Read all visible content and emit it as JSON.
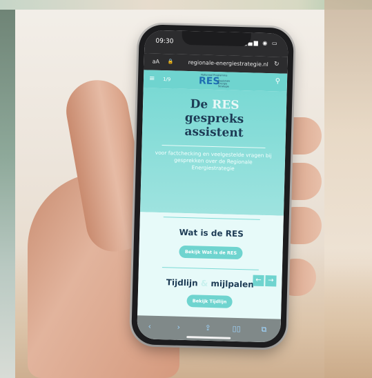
{
  "status": {
    "time": "09:30",
    "icons": "▂▄▆ ◉ ▭"
  },
  "browser": {
    "aa": "aA",
    "lock": "🔒",
    "url": "regionale-energiestrategie.nl",
    "reload": "↻"
  },
  "site": {
    "menu_icon": "≡",
    "pager": "1/9",
    "logo_sub": "Nationaal Programma",
    "logo": "RES",
    "logo_tag": "Regionale Energie Strategie",
    "search_icon": "⚲"
  },
  "hero": {
    "title_de": "De ",
    "title_res": "RES",
    "title_line2": "gespreks",
    "title_line3": "assistent",
    "intro": "voor factchecking en veelgestelde vragen bij gesprekken over de Regionale Energiestrategie"
  },
  "section1": {
    "heading": "Wat is de RES",
    "button": "Bekijk Wat is de RES"
  },
  "section2": {
    "heading_a": "Tijdlijn ",
    "heading_amp": "&",
    "heading_b": " mijlpalen",
    "button": "Bekijk Tijdlijn"
  },
  "nav": {
    "prev": "←",
    "next": "→"
  },
  "toolbar": {
    "back": "‹",
    "forward": "›",
    "share": "⇪",
    "bookmarks": "▯▯",
    "tabs": "⧉"
  }
}
